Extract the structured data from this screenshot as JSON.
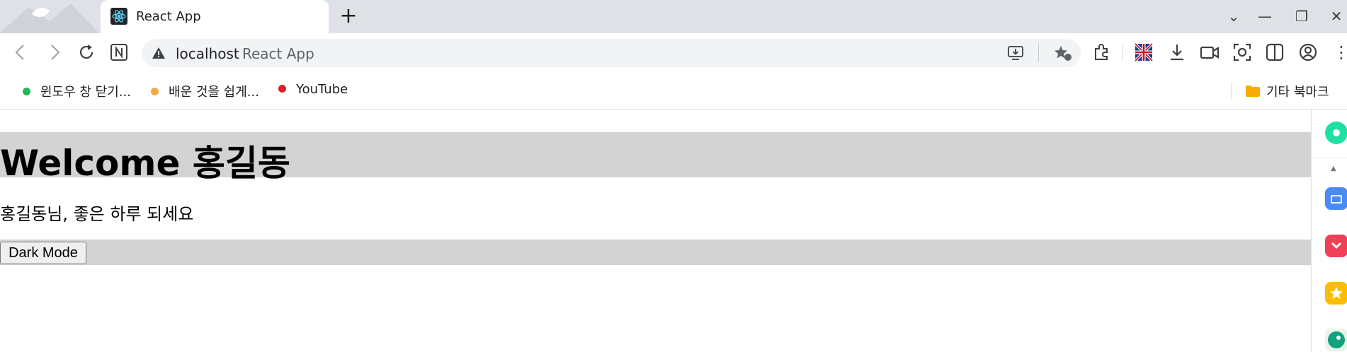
{
  "tab": {
    "title": "React App"
  },
  "window_controls": {
    "tab_list": "⌄",
    "minimize": "—",
    "restore": "❐",
    "close": "✕"
  },
  "toolbar": {
    "url_host": "localhost",
    "url_title": "React App",
    "more": "⋮"
  },
  "bookmarks": [
    {
      "label": "윈도우 창 닫기...",
      "color": "#1db954"
    },
    {
      "label": "배운 것을 쉽게...",
      "color": "#f4a742"
    },
    {
      "label": "YouTube",
      "color": "#e31b23"
    }
  ],
  "other_bookmarks": "기타 북마크",
  "page": {
    "heading": "Welcome 홍길동",
    "greeting": "홍길동님, 좋은 하루 되세요",
    "dark_mode_button": "Dark Mode"
  },
  "colors": {
    "header_bg": "#d3d3d3",
    "titlebar_bg": "#dee1e6"
  }
}
